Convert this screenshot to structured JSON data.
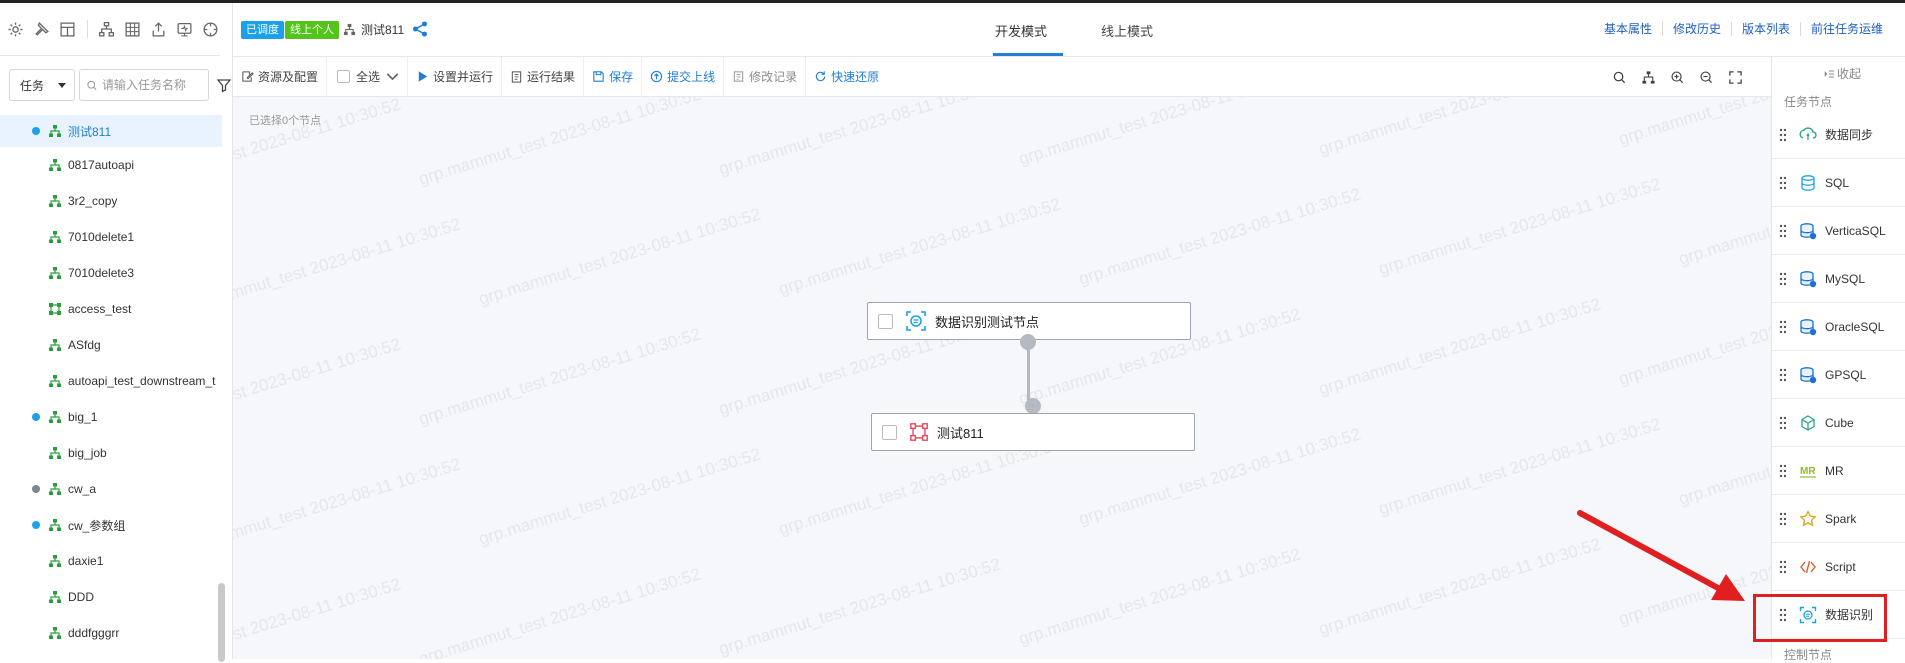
{
  "sidebar": {
    "type_select": "任务",
    "search_placeholder": "请输入任务名称",
    "items": [
      {
        "label": "测试811",
        "dot": "blue",
        "icon": "flow",
        "selected": true
      },
      {
        "label": "0817autoapi",
        "dot": "",
        "icon": "flow"
      },
      {
        "label": "3r2_copy",
        "dot": "",
        "icon": "flow"
      },
      {
        "label": "7010delete1",
        "dot": "",
        "icon": "flow"
      },
      {
        "label": "7010delete3",
        "dot": "",
        "icon": "flow"
      },
      {
        "label": "access_test",
        "dot": "",
        "icon": "subflow"
      },
      {
        "label": "ASfdg",
        "dot": "",
        "icon": "flow"
      },
      {
        "label": "autoapi_test_downstream_t",
        "dot": "",
        "icon": "flow"
      },
      {
        "label": "big_1",
        "dot": "blue",
        "icon": "flow"
      },
      {
        "label": "big_job",
        "dot": "",
        "icon": "flow"
      },
      {
        "label": "cw_a",
        "dot": "gray",
        "icon": "flow"
      },
      {
        "label": "cw_参数组",
        "dot": "blue",
        "icon": "flow"
      },
      {
        "label": "daxie1",
        "dot": "",
        "icon": "flow"
      },
      {
        "label": "DDD",
        "dot": "",
        "icon": "flow"
      },
      {
        "label": "dddfgggrr",
        "dot": "",
        "icon": "flow"
      }
    ]
  },
  "header": {
    "badge_scheduled": "已调度",
    "badge_online": "线上个人",
    "task_name": "测试811",
    "tab_dev": "开发模式",
    "tab_online": "线上模式",
    "links": [
      "基本属性",
      "修改历史",
      "版本列表",
      "前往任务运维"
    ]
  },
  "toolbar": {
    "resources": "资源及配置",
    "select_all": "全选",
    "set_run": "设置并运行",
    "run_result": "运行结果",
    "save": "保存",
    "submit": "提交上线",
    "edit_log": "修改记录",
    "restore": "快速还原"
  },
  "canvas": {
    "selected_info": "已选择0个节点",
    "watermark": "grp.mammut_test 2023-08-11 10:30:52",
    "nodes": [
      {
        "label": "数据识别测试节点",
        "icon": "data-identify-icon"
      },
      {
        "label": "测试811",
        "icon": "subflow-icon"
      }
    ]
  },
  "palette": {
    "collapse": "收起",
    "task_section": "任务节点",
    "control_section": "控制节点",
    "items": [
      {
        "label": "数据同步",
        "icon": "sync-icon"
      },
      {
        "label": "SQL",
        "icon": "sql-icon"
      },
      {
        "label": "VerticaSQL",
        "icon": "vertica-icon"
      },
      {
        "label": "MySQL",
        "icon": "mysql-icon"
      },
      {
        "label": "OracleSQL",
        "icon": "oracle-icon"
      },
      {
        "label": "GPSQL",
        "icon": "gpsql-icon"
      },
      {
        "label": "Cube",
        "icon": "cube-icon"
      },
      {
        "label": "MR",
        "icon": "mr-icon"
      },
      {
        "label": "Spark",
        "icon": "spark-icon"
      },
      {
        "label": "Script",
        "icon": "script-icon"
      },
      {
        "label": "数据识别",
        "icon": "data-identify-icon",
        "highlighted": true
      }
    ]
  },
  "colors": {
    "accent": "#1f7ed6",
    "badge_blue": "#1aa1e8",
    "badge_green": "#52c41a",
    "highlight": "#e02020"
  }
}
